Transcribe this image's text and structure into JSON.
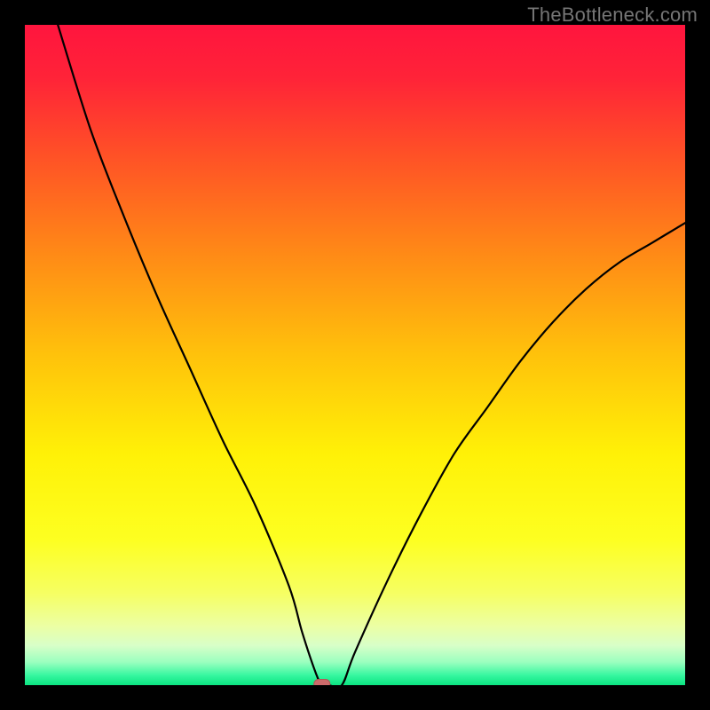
{
  "watermark": "TheBottleneck.com",
  "chart_data": {
    "type": "line",
    "title": "",
    "xlabel": "",
    "ylabel": "",
    "xlim": [
      0,
      100
    ],
    "ylim": [
      0,
      100
    ],
    "x": [
      5,
      10,
      15,
      20,
      25,
      30,
      35,
      40,
      42,
      44,
      45,
      46,
      48,
      50,
      55,
      60,
      65,
      70,
      75,
      80,
      85,
      90,
      95,
      100
    ],
    "y": [
      100,
      84,
      71,
      59,
      48,
      37,
      27,
      15,
      8,
      2,
      0,
      0,
      0,
      5,
      16,
      26,
      35,
      42,
      49,
      55,
      60,
      64,
      67,
      70
    ],
    "minimum_marker": {
      "x": 45,
      "y": 0
    },
    "background_gradient": {
      "stops": [
        {
          "pos": 0.0,
          "color": "#ff153e"
        },
        {
          "pos": 0.08,
          "color": "#ff2338"
        },
        {
          "pos": 0.2,
          "color": "#ff5226"
        },
        {
          "pos": 0.35,
          "color": "#ff8b16"
        },
        {
          "pos": 0.5,
          "color": "#ffc20b"
        },
        {
          "pos": 0.65,
          "color": "#fff107"
        },
        {
          "pos": 0.78,
          "color": "#fdff21"
        },
        {
          "pos": 0.86,
          "color": "#f6ff62"
        },
        {
          "pos": 0.91,
          "color": "#ecffa3"
        },
        {
          "pos": 0.94,
          "color": "#d8ffc8"
        },
        {
          "pos": 0.965,
          "color": "#9bffbf"
        },
        {
          "pos": 0.985,
          "color": "#37f7a0"
        },
        {
          "pos": 1.0,
          "color": "#0be481"
        }
      ]
    },
    "curve_stroke": "#000000",
    "curve_width": 2.2,
    "marker_fill": "#cc6b6b",
    "marker_stroke": "#b25757"
  }
}
